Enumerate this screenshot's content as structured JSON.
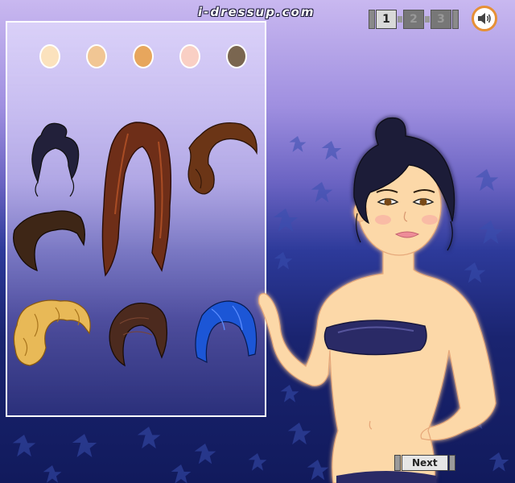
{
  "header": {
    "logo_text": "i-dressup.com",
    "pages": [
      "1",
      "2",
      "3"
    ],
    "active_page": "1",
    "sound_icon": "speaker-icon"
  },
  "skin_tones": [
    "#fbe2bd",
    "#f1c694",
    "#e7a65d",
    "#f9cfc4",
    "#7a6650"
  ],
  "hairstyles": [
    {
      "name": "dark-updo",
      "color": "#22203a"
    },
    {
      "name": "long-auburn",
      "color": "#6e2e18"
    },
    {
      "name": "brown-side-curl",
      "color": "#6b3516"
    },
    {
      "name": "brown-swept-bob",
      "color": "#3e2616"
    },
    {
      "name": "blonde-curly-updo",
      "color": "#e8b957"
    },
    {
      "name": "brown-messy-updo",
      "color": "#4c2a1e"
    },
    {
      "name": "blue-bob",
      "color": "#1c56d6"
    }
  ],
  "controls": {
    "next_label": "Next"
  }
}
